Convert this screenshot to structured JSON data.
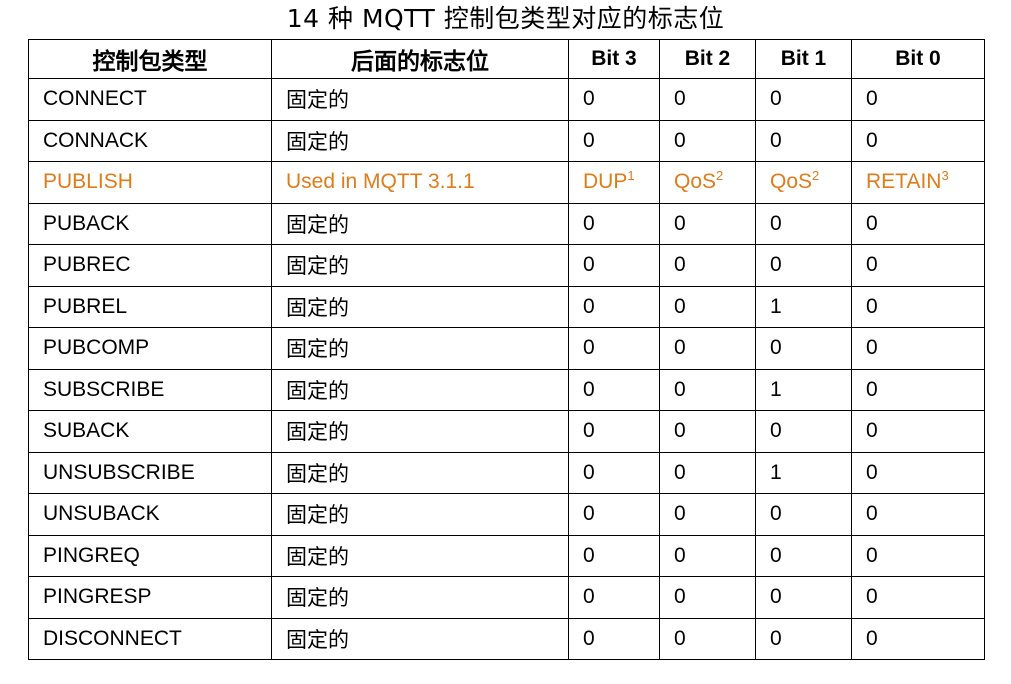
{
  "caption": "14 种 MQTT 控制包类型对应的标志位",
  "headers": {
    "type": "控制包类型",
    "flags": "后面的标志位",
    "bit3": "Bit 3",
    "bit2": "Bit 2",
    "bit1": "Bit 1",
    "bit0": "Bit 0"
  },
  "highlight_color": "#e07b1a",
  "rows": [
    {
      "type": "CONNECT",
      "flags": "固定的",
      "bit3": "0",
      "bit2": "0",
      "bit1": "0",
      "bit0": "0"
    },
    {
      "type": "CONNACK",
      "flags": "固定的",
      "bit3": "0",
      "bit2": "0",
      "bit1": "0",
      "bit0": "0"
    },
    {
      "type": "PUBLISH",
      "flags": "Used in MQTT 3.1.1",
      "bit3": "DUP",
      "bit3_sup": "1",
      "bit2": "QoS",
      "bit2_sup": "2",
      "bit1": "QoS",
      "bit1_sup": "2",
      "bit0": "RETAIN",
      "bit0_sup": "3"
    },
    {
      "type": "PUBACK",
      "flags": "固定的",
      "bit3": "0",
      "bit2": "0",
      "bit1": "0",
      "bit0": "0"
    },
    {
      "type": "PUBREC",
      "flags": "固定的",
      "bit3": "0",
      "bit2": "0",
      "bit1": "0",
      "bit0": "0"
    },
    {
      "type": "PUBREL",
      "flags": "固定的",
      "bit3": "0",
      "bit2": "0",
      "bit1": "1",
      "bit0": "0"
    },
    {
      "type": "PUBCOMP",
      "flags": "固定的",
      "bit3": "0",
      "bit2": "0",
      "bit1": "0",
      "bit0": "0"
    },
    {
      "type": "SUBSCRIBE",
      "flags": "固定的",
      "bit3": "0",
      "bit2": "0",
      "bit1": "1",
      "bit0": "0"
    },
    {
      "type": "SUBACK",
      "flags": "固定的",
      "bit3": "0",
      "bit2": "0",
      "bit1": "0",
      "bit0": "0"
    },
    {
      "type": "UNSUBSCRIBE",
      "flags": "固定的",
      "bit3": "0",
      "bit2": "0",
      "bit1": "1",
      "bit0": "0"
    },
    {
      "type": "UNSUBACK",
      "flags": "固定的",
      "bit3": "0",
      "bit2": "0",
      "bit1": "0",
      "bit0": "0"
    },
    {
      "type": "PINGREQ",
      "flags": "固定的",
      "bit3": "0",
      "bit2": "0",
      "bit1": "0",
      "bit0": "0"
    },
    {
      "type": "PINGRESP",
      "flags": "固定的",
      "bit3": "0",
      "bit2": "0",
      "bit1": "0",
      "bit0": "0"
    },
    {
      "type": "DISCONNECT",
      "flags": "固定的",
      "bit3": "0",
      "bit2": "0",
      "bit1": "0",
      "bit0": "0"
    }
  ]
}
